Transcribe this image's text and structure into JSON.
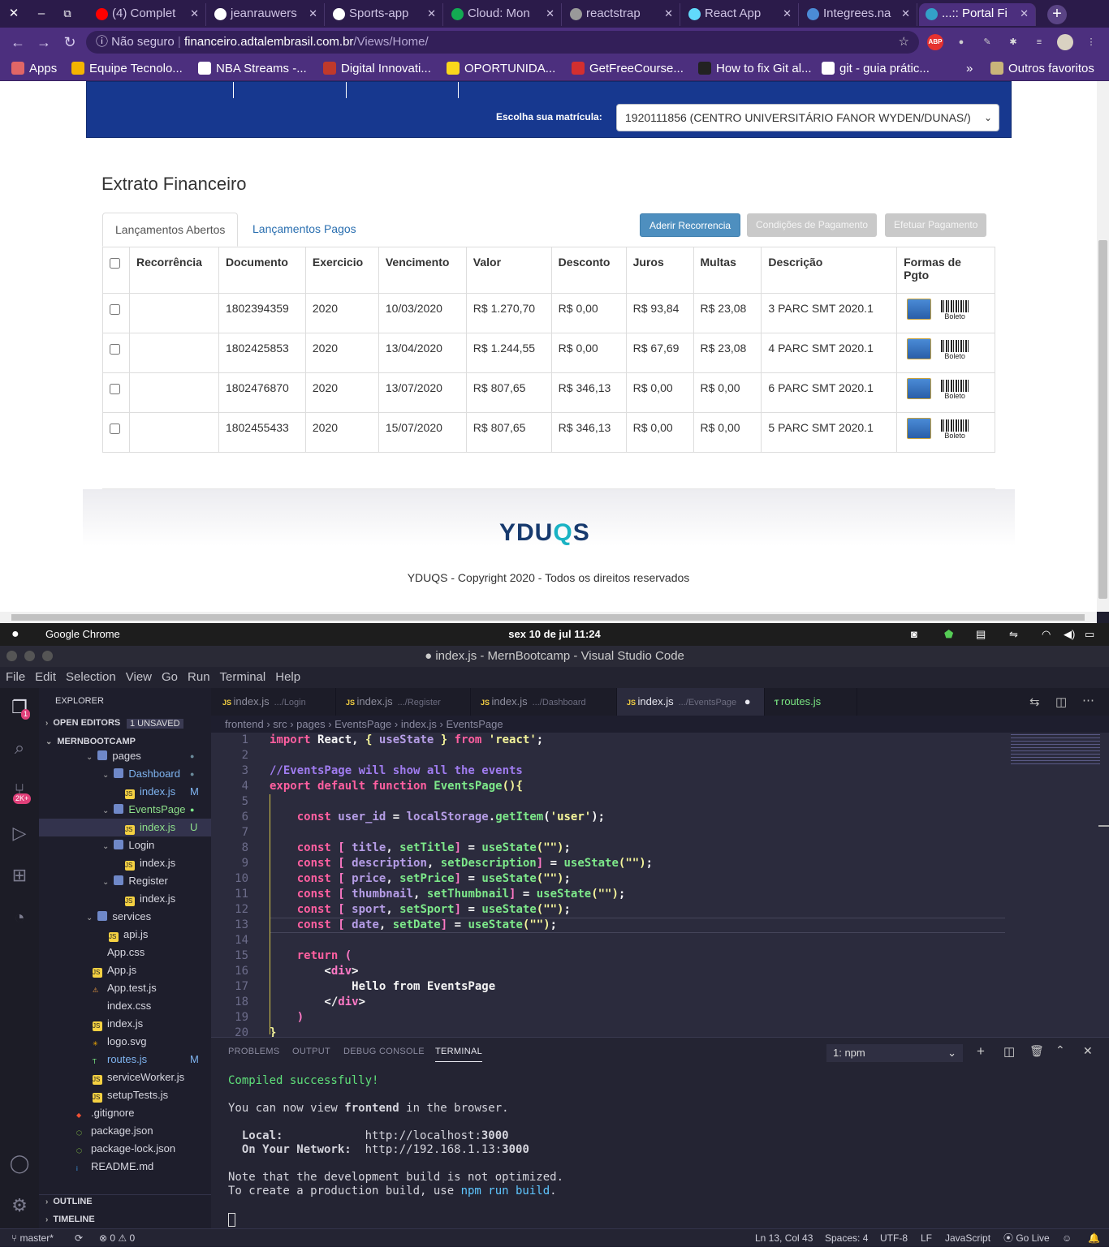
{
  "browser": {
    "tabs": [
      {
        "label": "(4) Complet",
        "color": "#ff0000"
      },
      {
        "label": "jeanrauwers",
        "color": "#ffffff"
      },
      {
        "label": "Sports-app",
        "color": "#ffffff"
      },
      {
        "label": "Cloud: Mon",
        "color": "#13aa52"
      },
      {
        "label": "reactstrap",
        "color": "#999999"
      },
      {
        "label": "React App",
        "color": "#61dafb"
      },
      {
        "label": "Integrees.na",
        "color": "#4b8bd6"
      },
      {
        "label": "...:: Portal Fi",
        "color": "#33a0c8"
      }
    ],
    "security_label": "Não seguro",
    "url_host": "financeiro.adtalembrasil.com.br",
    "url_path": "/Views/Home/",
    "bookmarks": [
      "Apps",
      "Equipe Tecnolo...",
      "NBA Streams -...",
      "Digital Innovati...",
      "OPORTUNIDA...",
      "GetFreeCourse...",
      "How to fix Git al...",
      "git - guia prátic...",
      "Outros favoritos"
    ],
    "ext_abp": "ABP"
  },
  "portal": {
    "matricula_label": "Escolha sua matrícula:",
    "matricula_value": "1920111856 (CENTRO UNIVERSITÁRIO FANOR WYDEN/DUNAS/)",
    "title": "Extrato Financeiro",
    "tab_open": "Lançamentos Abertos",
    "tab_paid": "Lançamentos Pagos",
    "btn_recorrencia": "Aderir Recorrencia",
    "btn_condicoes": "Condições de Pagamento",
    "btn_pagamento": "Efetuar Pagamento",
    "columns": [
      "Recorrência",
      "Documento",
      "Exercicio",
      "Vencimento",
      "Valor",
      "Desconto",
      "Juros",
      "Multas",
      "Descrição",
      "Formas de Pgto"
    ],
    "rows": [
      {
        "recorrencia": "",
        "documento": "1802394359",
        "exercicio": "2020",
        "vencimento": "10/03/2020",
        "valor": "R$ 1.270,70",
        "desconto": "R$ 0,00",
        "juros": "R$ 93,84",
        "multas": "R$ 23,08",
        "descricao": "3 PARC SMT 2020.1"
      },
      {
        "recorrencia": "",
        "documento": "1802425853",
        "exercicio": "2020",
        "vencimento": "13/04/2020",
        "valor": "R$ 1.244,55",
        "desconto": "R$ 0,00",
        "juros": "R$ 67,69",
        "multas": "R$ 23,08",
        "descricao": "4 PARC SMT 2020.1"
      },
      {
        "recorrencia": "",
        "documento": "1802476870",
        "exercicio": "2020",
        "vencimento": "13/07/2020",
        "valor": "R$ 807,65",
        "desconto": "R$ 346,13",
        "juros": "R$ 0,00",
        "multas": "R$ 0,00",
        "descricao": "6 PARC SMT 2020.1"
      },
      {
        "recorrencia": "",
        "documento": "1802455433",
        "exercicio": "2020",
        "vencimento": "15/07/2020",
        "valor": "R$ 807,65",
        "desconto": "R$ 346,13",
        "juros": "R$ 0,00",
        "multas": "R$ 0,00",
        "descricao": "5 PARC SMT 2020.1"
      }
    ],
    "boleto_label": "Boleto",
    "logo_main": "YDU",
    "logo_q": "Q",
    "logo_end": "S",
    "copyright": "YDUQS - Copyright 2020 - Todos os direitos reservados"
  },
  "macbar": {
    "app": "Google Chrome",
    "datetime": "sex 10 de jul  11:24"
  },
  "vscode": {
    "title": "● index.js - MernBootcamp - Visual Studio Code",
    "menu": [
      "File",
      "Edit",
      "Selection",
      "View",
      "Go",
      "Run",
      "Terminal",
      "Help"
    ],
    "explorer_label": "EXPLORER",
    "open_editors": "OPEN EDITORS",
    "unsaved": "1 UNSAVED",
    "project": "MERNBOOTCAMP",
    "scm_badge": "1",
    "ext_badge": "2K+",
    "tree": [
      {
        "name": "pages",
        "depth": 1,
        "type": "folder",
        "color": "#d7d7e0"
      },
      {
        "name": "Dashboard",
        "depth": 2,
        "type": "folder",
        "color": "#7fb4f0"
      },
      {
        "name": "index.js",
        "depth": 3,
        "type": "js",
        "color": "#7fb4f0",
        "status": "M"
      },
      {
        "name": "EventsPage",
        "depth": 2,
        "type": "folder",
        "color": "#8ee08a"
      },
      {
        "name": "index.js",
        "depth": 3,
        "type": "js",
        "color": "#8ee08a",
        "status": "U"
      },
      {
        "name": "Login",
        "depth": 2,
        "type": "folder",
        "color": "#d7d7e0"
      },
      {
        "name": "index.js",
        "depth": 3,
        "type": "js",
        "color": "#d7d7e0"
      },
      {
        "name": "Register",
        "depth": 2,
        "type": "folder",
        "color": "#d7d7e0"
      },
      {
        "name": "index.js",
        "depth": 3,
        "type": "js",
        "color": "#d7d7e0"
      },
      {
        "name": "services",
        "depth": 1,
        "type": "folder",
        "color": "#d7d7e0"
      },
      {
        "name": "api.js",
        "depth": 2,
        "type": "js",
        "color": "#d7d7e0"
      },
      {
        "name": "App.css",
        "depth": 1,
        "type": "css",
        "color": "#d7d7e0"
      },
      {
        "name": "App.js",
        "depth": 1,
        "type": "js",
        "color": "#d7d7e0"
      },
      {
        "name": "App.test.js",
        "depth": 1,
        "type": "test",
        "color": "#d7d7e0"
      },
      {
        "name": "index.css",
        "depth": 1,
        "type": "css",
        "color": "#d7d7e0"
      },
      {
        "name": "index.js",
        "depth": 1,
        "type": "js",
        "color": "#d7d7e0"
      },
      {
        "name": "logo.svg",
        "depth": 1,
        "type": "svg",
        "color": "#d7d7e0"
      },
      {
        "name": "routes.js",
        "depth": 1,
        "type": "route",
        "color": "#7fb4f0",
        "status": "M"
      },
      {
        "name": "serviceWorker.js",
        "depth": 1,
        "type": "js",
        "color": "#d7d7e0"
      },
      {
        "name": "setupTests.js",
        "depth": 1,
        "type": "js",
        "color": "#d7d7e0"
      },
      {
        "name": ".gitignore",
        "depth": 0,
        "type": "git",
        "color": "#d7d7e0"
      },
      {
        "name": "package.json",
        "depth": 0,
        "type": "node",
        "color": "#d7d7e0"
      },
      {
        "name": "package-lock.json",
        "depth": 0,
        "type": "node",
        "color": "#d7d7e0"
      },
      {
        "name": "README.md",
        "depth": 0,
        "type": "info",
        "color": "#d7d7e0"
      }
    ],
    "outline": "OUTLINE",
    "timeline": "TIMELINE",
    "editor_tabs": [
      {
        "name": "index.js",
        "sub": ".../Login"
      },
      {
        "name": "index.js",
        "sub": ".../Register"
      },
      {
        "name": "index.js",
        "sub": ".../Dashboard"
      },
      {
        "name": "index.js",
        "sub": ".../EventsPage"
      },
      {
        "name": "routes.js",
        "sub": ""
      }
    ],
    "breadcrumb": [
      "frontend",
      "src",
      "pages",
      "EventsPage",
      "index.js",
      "EventsPage"
    ],
    "panel_tabs": [
      "PROBLEMS",
      "OUTPUT",
      "DEBUG CONSOLE",
      "TERMINAL"
    ],
    "terminal_select": "1: npm",
    "terminal": {
      "compiled": "Compiled successfully!",
      "view_pre": "You can now view ",
      "view_app": "frontend",
      "view_post": " in the browser.",
      "local_label": "  Local:            ",
      "local_url": "http://localhost:",
      "local_port": "3000",
      "net_label": "  On Your Network:  ",
      "net_url": "http://192.168.1.13:",
      "net_port": "3000",
      "note1": "Note that the development build is not optimized.",
      "note2_pre": "To create a production build, use ",
      "note2_cmd": "npm run build",
      "note2_post": "."
    },
    "status": {
      "branch": "master*",
      "problems": "⊗ 0 ⚠ 0",
      "position": "Ln 13, Col 43",
      "spaces": "Spaces: 4",
      "encoding": "UTF-8",
      "eol": "LF",
      "language": "JavaScript",
      "golive": "Go Live"
    }
  }
}
